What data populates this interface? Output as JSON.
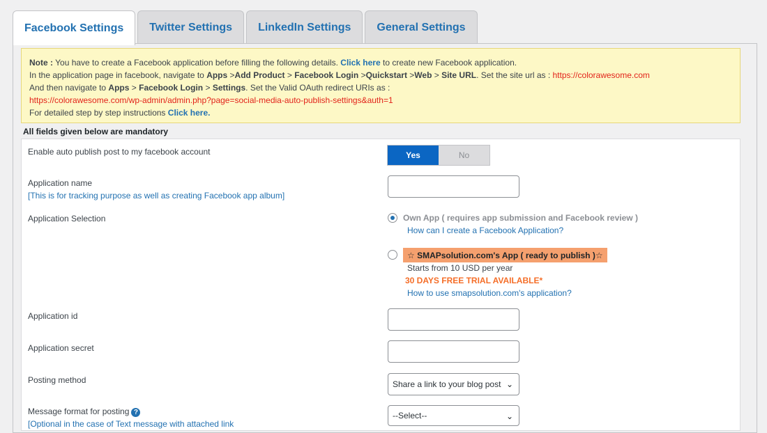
{
  "tabs": [
    {
      "label": "Facebook Settings",
      "active": true
    },
    {
      "label": "Twitter Settings"
    },
    {
      "label": "LinkedIn Settings"
    },
    {
      "label": "General Settings"
    }
  ],
  "note": {
    "l1_note": "Note :",
    "l1_a": " You have to create a Facebook application before filling the following details. ",
    "l1_link": "Click here",
    "l1_b": " to create new Facebook application.",
    "l2_a": "In the application page in facebook, navigate to ",
    "l2_b1": "Apps",
    "l2_s1": " >",
    "l2_b2": "Add Product",
    "l2_s2": " > ",
    "l2_b3": "Facebook Login",
    "l2_s3": " >",
    "l2_b4": "Quickstart",
    "l2_s4": " >",
    "l2_b5": "Web",
    "l2_s5": " > ",
    "l2_b6": "Site URL",
    "l2_c": ". Set the site url as : ",
    "l2_url": "https://colorawesome.com",
    "l3_a": "And then navigate to ",
    "l3_b1": "Apps",
    "l3_s1": " > ",
    "l3_b2": "Facebook Login",
    "l3_s2": " > ",
    "l3_b3": "Settings",
    "l3_c": ". Set the Valid OAuth redirect URIs as :",
    "l4_url": "https://colorawesome.com/wp-admin/admin.php?page=social-media-auto-publish-settings&auth=1",
    "l5_a": "For detailed step by step instructions ",
    "l5_link": "Click here."
  },
  "mandatory": "All fields given below are mandatory",
  "fields": {
    "enable": {
      "label": "Enable auto publish post to my facebook account",
      "yes": "Yes",
      "no": "No"
    },
    "app_name": {
      "label": "Application name",
      "sub": "[This is for tracking purpose as well as creating Facebook app album]",
      "value": ""
    },
    "selection": {
      "label": "Application Selection",
      "own_label": "Own App ( requires app submission and Facebook review )",
      "own_link": "How can I create a Facebook Application?",
      "smap_label": "☆ SMAPsolution.com's App ( ready to publish )☆",
      "smap_price": "Starts from 10 USD per year",
      "smap_trial": "30 DAYS FREE TRIAL AVAILABLE*",
      "smap_link": "How to use smapsolution.com's application?"
    },
    "app_id": {
      "label": "Application id",
      "value": ""
    },
    "app_secret": {
      "label": "Application secret",
      "value": ""
    },
    "posting": {
      "label": "Posting method",
      "value": "Share a link to your blog post"
    },
    "format": {
      "label": "Message format for posting",
      "sub": "[Optional in the case of Text message with attached link",
      "value": "--Select--"
    }
  },
  "icons": {
    "chevron": "chevron-down-icon",
    "help": "help-icon",
    "radio": "radio-icon"
  }
}
